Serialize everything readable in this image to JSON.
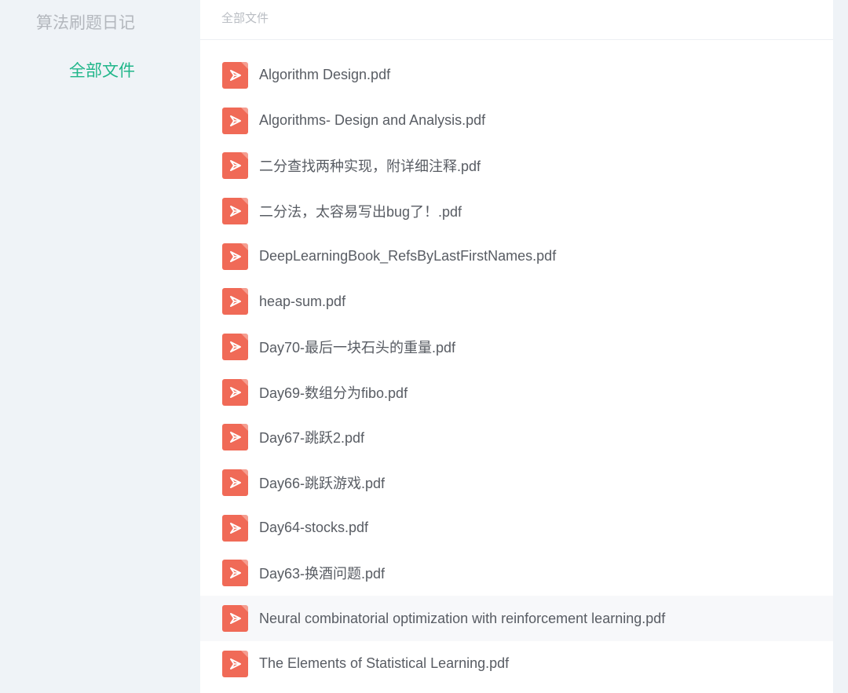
{
  "sidebar": {
    "title": "算法刷题日记",
    "nav": [
      {
        "label": "全部文件",
        "active": true
      }
    ],
    "active_color": "#20b68a"
  },
  "main": {
    "breadcrumb": "全部文件",
    "files": [
      {
        "name": "Algorithm Design.pdf",
        "icon": "pdf-icon"
      },
      {
        "name": "Algorithms- Design and Analysis.pdf",
        "icon": "pdf-icon"
      },
      {
        "name": "二分查找两种实现，附详细注释.pdf",
        "icon": "pdf-icon"
      },
      {
        "name": "二分法，太容易写出bug了！.pdf",
        "icon": "pdf-icon"
      },
      {
        "name": "DeepLearningBook_RefsByLastFirstNames.pdf",
        "icon": "pdf-icon"
      },
      {
        "name": "heap-sum.pdf",
        "icon": "pdf-icon"
      },
      {
        "name": "Day70-最后一块石头的重量.pdf",
        "icon": "pdf-icon"
      },
      {
        "name": "Day69-数组分为fibo.pdf",
        "icon": "pdf-icon"
      },
      {
        "name": "Day67-跳跃2.pdf",
        "icon": "pdf-icon"
      },
      {
        "name": "Day66-跳跃游戏.pdf",
        "icon": "pdf-icon"
      },
      {
        "name": "Day64-stocks.pdf",
        "icon": "pdf-icon"
      },
      {
        "name": "Day63-换酒问题.pdf",
        "icon": "pdf-icon"
      },
      {
        "name": "Neural combinatorial optimization with reinforcement learning.pdf",
        "icon": "pdf-icon",
        "hovered": true
      },
      {
        "name": "The Elements of Statistical Learning.pdf",
        "icon": "pdf-icon"
      }
    ],
    "pdf_icon_color": "#f06a57"
  }
}
